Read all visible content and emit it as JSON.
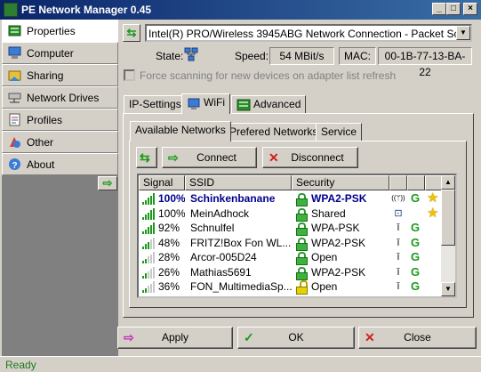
{
  "window": {
    "title": "PE Network Manager 0.45"
  },
  "sidebar": {
    "items": [
      {
        "label": "Properties",
        "icon": "properties-icon"
      },
      {
        "label": "Computer",
        "icon": "computer-icon"
      },
      {
        "label": "Sharing",
        "icon": "sharing-icon"
      },
      {
        "label": "Network Drives",
        "icon": "network-drive-icon"
      },
      {
        "label": "Profiles",
        "icon": "profiles-icon"
      },
      {
        "label": "Other",
        "icon": "other-icon"
      },
      {
        "label": "About",
        "icon": "help-icon"
      }
    ],
    "active_index": 0
  },
  "adapter": {
    "selected": "Intel(R) PRO/Wireless 3945ABG Network Connection - Packet Scheduler",
    "state_label": "State:",
    "speed_label": "Speed:",
    "speed_value": "54 MBit/s",
    "mac_label": "MAC:",
    "mac_value": "00-1B-77-13-BA-22",
    "force_scan_label": "Force scanning for new devices on adapter list refresh"
  },
  "tabs": [
    {
      "label": "IP-Settings"
    },
    {
      "label": "WiFi"
    },
    {
      "label": "Advanced"
    }
  ],
  "subtabs": [
    {
      "label": "Available Networks"
    },
    {
      "label": "Prefered Networks"
    },
    {
      "label": "Service"
    }
  ],
  "actions": {
    "connect": "Connect",
    "disconnect": "Disconnect"
  },
  "networks": {
    "columns": [
      "Signal",
      "SSID",
      "Security"
    ],
    "rows": [
      {
        "signal": "100%",
        "ssid": "Schinkenbanane",
        "security": "WPA2-PSK",
        "locked": true,
        "bold": true,
        "bars": 5,
        "connected": true,
        "g": true,
        "star": true
      },
      {
        "signal": "100%",
        "ssid": "MeinAdhock",
        "security": "Shared",
        "locked": true,
        "bold": false,
        "bars": 5,
        "adhoc": true,
        "g": false,
        "star": true
      },
      {
        "signal": "92%",
        "ssid": "Schnulfel",
        "security": "WPA-PSK",
        "locked": true,
        "bold": false,
        "bars": 5,
        "g": true,
        "star": false
      },
      {
        "signal": "48%",
        "ssid": "FRITZ!Box Fon WL...",
        "security": "WPA2-PSK",
        "locked": true,
        "bold": false,
        "bars": 3,
        "g": true,
        "star": false
      },
      {
        "signal": "28%",
        "ssid": "Arcor-005D24",
        "security": "Open",
        "locked": true,
        "bold": false,
        "bars": 2,
        "g": true,
        "star": false
      },
      {
        "signal": "26%",
        "ssid": "Mathias5691",
        "security": "WPA2-PSK",
        "locked": true,
        "bold": false,
        "bars": 2,
        "g": true,
        "star": false
      },
      {
        "signal": "36%",
        "ssid": "FON_MultimediaSp...",
        "security": "Open",
        "locked": false,
        "bold": false,
        "bars": 2,
        "g": true,
        "star": false
      }
    ]
  },
  "footer": {
    "apply": "Apply",
    "ok": "OK",
    "close": "Close"
  },
  "status": {
    "text": "Ready"
  },
  "colors": {
    "accent_green": "#1a9a1a",
    "connected_text": "#00008b",
    "titlebar": "#0a246a"
  }
}
